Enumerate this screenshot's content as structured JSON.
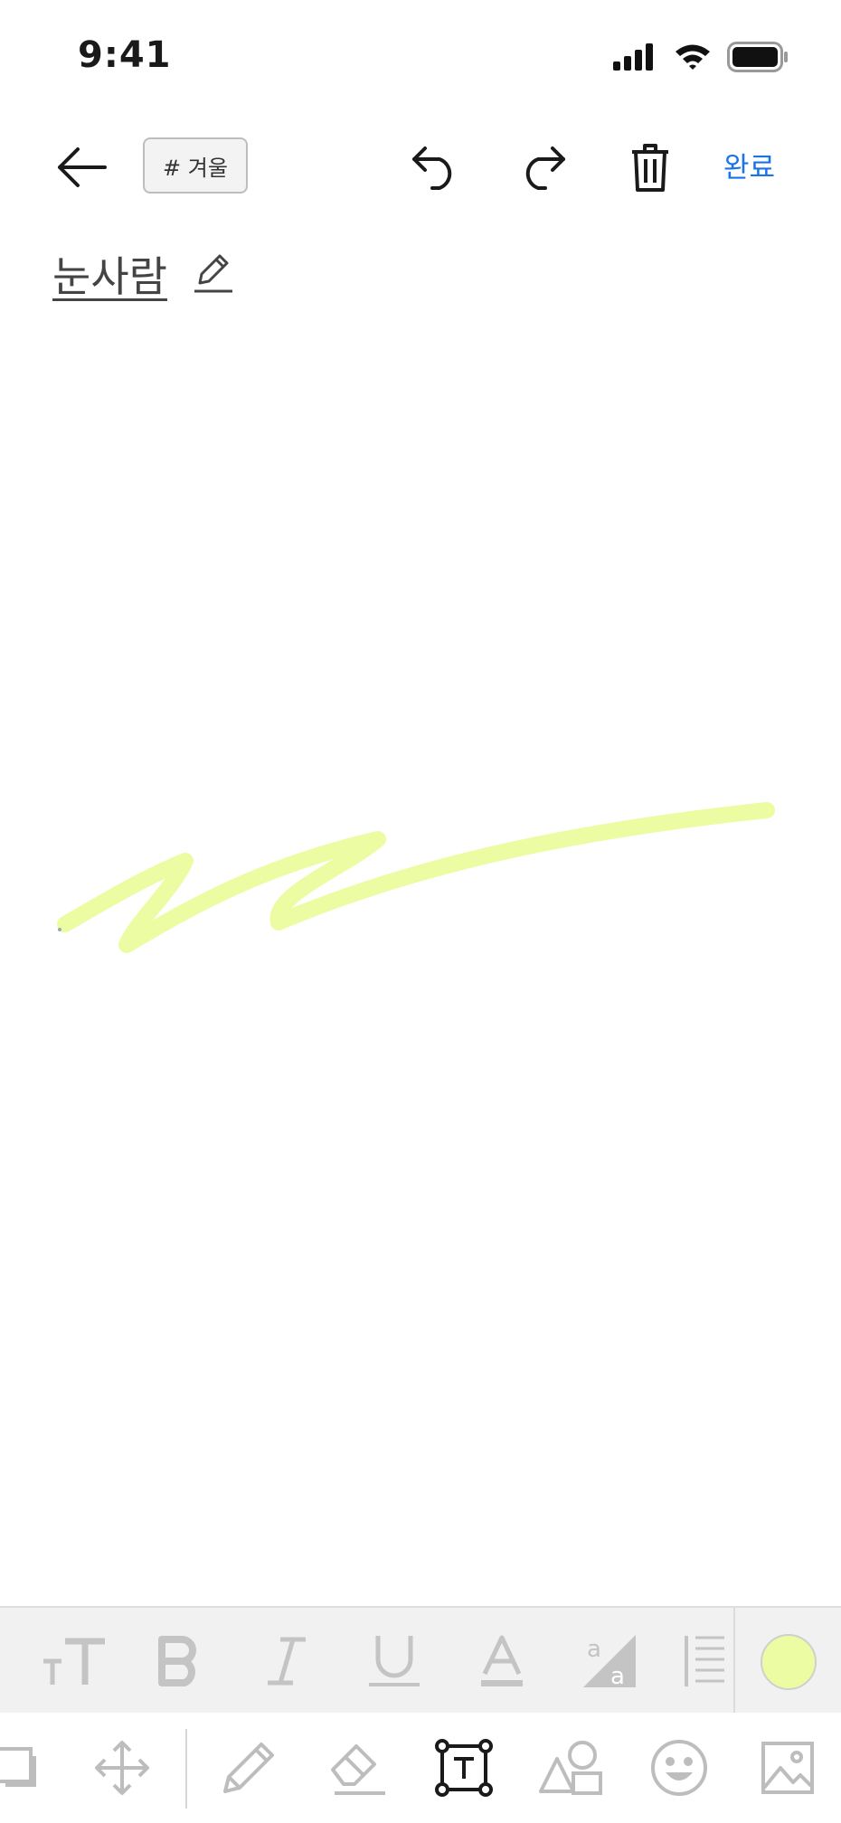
{
  "status_bar": {
    "time": "9:41"
  },
  "header": {
    "tag_label": "# 겨울",
    "done_label": "완료"
  },
  "note": {
    "title": "눈사람"
  },
  "stroke": {
    "color": "#ecfca2"
  },
  "icons": {
    "back": "arrow-left-icon",
    "undo": "undo-icon",
    "redo": "redo-icon",
    "delete": "trash-icon",
    "edit_title": "pencil-icon",
    "format": [
      "text-size-icon",
      "bold-icon",
      "italic-icon",
      "underline-icon",
      "font-color-icon",
      "highlight-icon",
      "line-spacing-icon"
    ],
    "tools": [
      "layers-icon",
      "move-icon",
      "pencil-icon",
      "eraser-icon",
      "text-box-icon",
      "shapes-icon",
      "emoji-icon",
      "image-icon"
    ]
  },
  "colors": {
    "accent": "#1a73e8",
    "selected_color": "#ecfca2",
    "inactive_icon": "#bdbdbd",
    "active_tool": "#1a1a1a"
  },
  "active_tool": "text-box"
}
